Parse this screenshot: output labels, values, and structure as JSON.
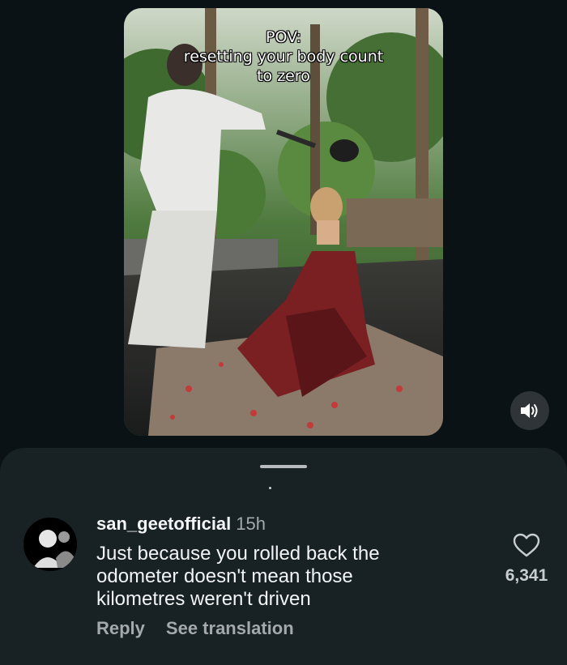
{
  "video": {
    "caption_lines": [
      "POV:",
      "resetting your body count",
      "to zero"
    ],
    "sound_icon": "speaker-icon"
  },
  "comment": {
    "username": "san_geetofficial",
    "time": "15h",
    "text_lines": [
      "Just because you rolled back the",
      "odometer doesn't mean those",
      "kilometres weren't driven"
    ],
    "reply_label": "Reply",
    "translate_label": "See translation",
    "like_icon": "heart-icon",
    "like_count": "6,341"
  },
  "colors": {
    "background": "#0b1215",
    "sheet": "#182124",
    "secondary_text": "#a3a9ad"
  }
}
